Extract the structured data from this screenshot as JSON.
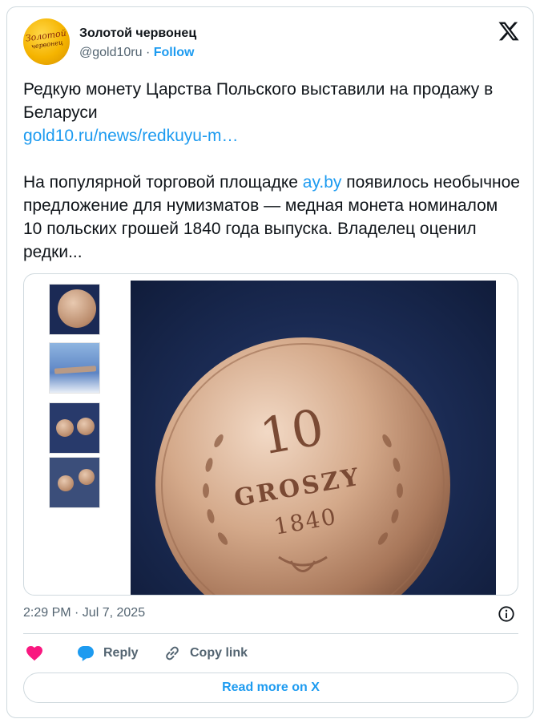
{
  "author": {
    "name": "Золотой червонец",
    "handle": "@gold10ru",
    "follow_label": "Follow",
    "avatar_logo": {
      "line1": "Золотой",
      "line2": "червонец"
    }
  },
  "tweet": {
    "line1": "Редкую монету Царства Польского выставили на продажу в Беларуси",
    "link": "gold10.ru/news/redkuyu-m…",
    "para_before": "На популярной торговой площадке ",
    "para_link": "ay.by",
    "para_after": " появилось необычное предложение для нумизматов — медная монета номиналом 10 польских грошей 1840 года выпуска. Владелец оценил редки..."
  },
  "media": {
    "coin_text": {
      "value": "10",
      "word": "GROSZY",
      "year": "1840"
    }
  },
  "timestamp": "2:29 PM · Jul 7, 2025",
  "actions": {
    "reply_label": "Reply",
    "copy_label": "Copy link"
  },
  "read_more_label": "Read more on X",
  "icons": [
    "x-logo-icon",
    "info-icon",
    "heart-icon",
    "reply-icon",
    "link-icon"
  ],
  "colors": {
    "accent": "#1d9bf0",
    "heart": "#f91880",
    "secondary_text": "#536471",
    "border": "#cfd9de"
  }
}
